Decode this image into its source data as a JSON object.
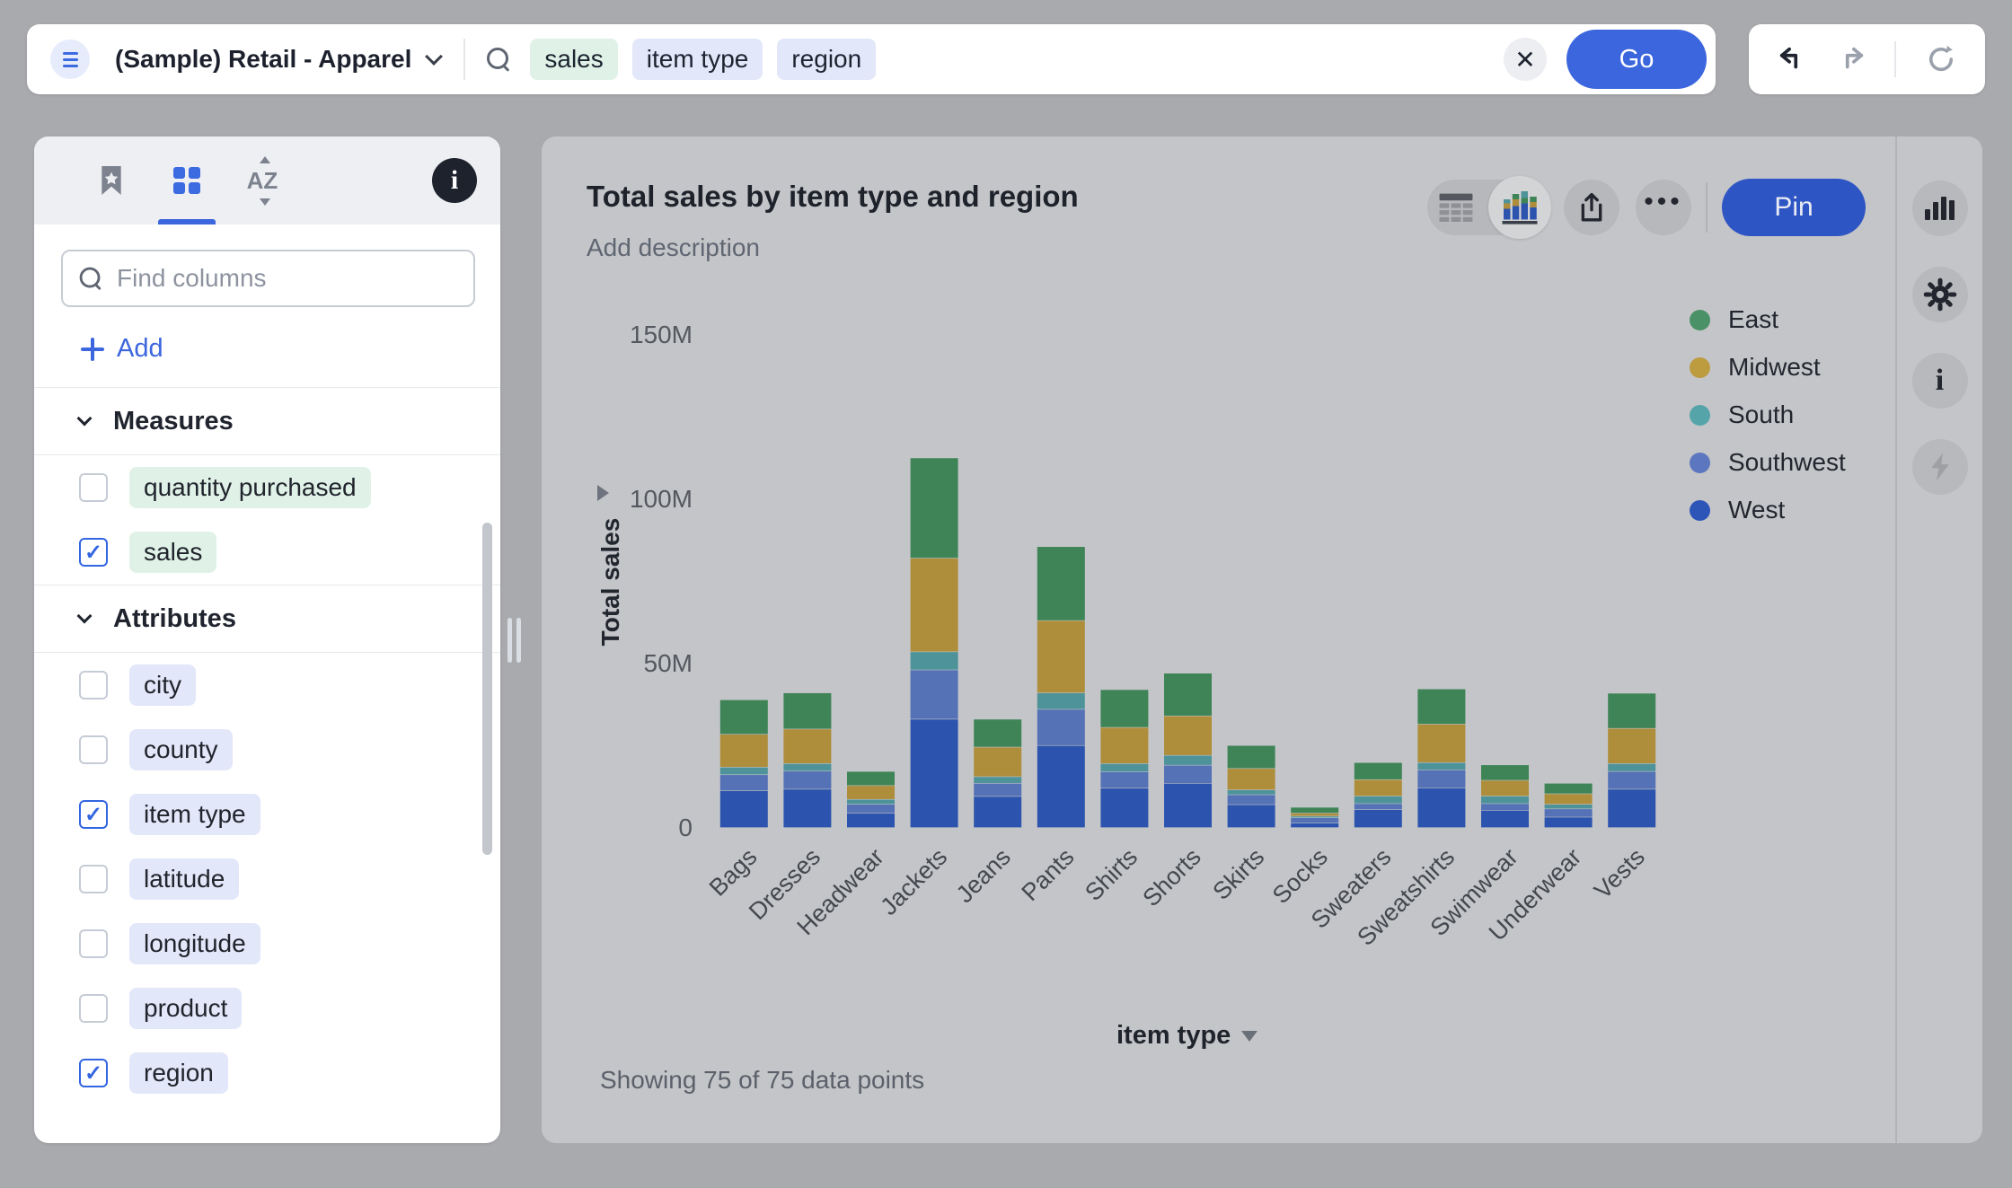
{
  "topbar": {
    "source_name": "(Sample) Retail - Apparel",
    "go_label": "Go",
    "tokens": [
      {
        "label": "sales",
        "kind": "measure"
      },
      {
        "label": "item type",
        "kind": "attribute"
      },
      {
        "label": "region",
        "kind": "attribute"
      }
    ]
  },
  "sidebar": {
    "search_placeholder": "Find columns",
    "add_label": "Add",
    "sections": [
      {
        "label": "Measures",
        "items": [
          {
            "label": "quantity purchased",
            "kind": "measure",
            "checked": false
          },
          {
            "label": "sales",
            "kind": "measure",
            "checked": true
          }
        ]
      },
      {
        "label": "Attributes",
        "items": [
          {
            "label": "city",
            "kind": "attribute",
            "checked": false
          },
          {
            "label": "county",
            "kind": "attribute",
            "checked": false
          },
          {
            "label": "item type",
            "kind": "attribute",
            "checked": true
          },
          {
            "label": "latitude",
            "kind": "attribute",
            "checked": false
          },
          {
            "label": "longitude",
            "kind": "attribute",
            "checked": false
          },
          {
            "label": "product",
            "kind": "attribute",
            "checked": false
          },
          {
            "label": "region",
            "kind": "attribute",
            "checked": true
          }
        ]
      }
    ]
  },
  "answer": {
    "title": "Total sales by item type and region",
    "description_placeholder": "Add description",
    "pin_label": "Pin",
    "status": "Showing 75 of 75 data points",
    "x_axis_label": "item type",
    "y_axis_label": "Total sales"
  },
  "chart_data": {
    "type": "bar",
    "stacked": true,
    "title": "Total sales by item type and region",
    "xlabel": "item type",
    "ylabel": "Total sales",
    "value_unit": "millions",
    "ylim": [
      0,
      150
    ],
    "y_ticks": [
      "0",
      "50M",
      "100M",
      "150M"
    ],
    "grid": false,
    "legend_position": "right",
    "categories": [
      "Bags",
      "Dresses",
      "Headwear",
      "Jackets",
      "Jeans",
      "Pants",
      "Shirts",
      "Shorts",
      "Skirts",
      "Socks",
      "Sweaters",
      "Sweatshirts",
      "Swimwear",
      "Underwear",
      "Vests"
    ],
    "stack_order_bottom_to_top": [
      "West",
      "Southwest",
      "South",
      "Midwest",
      "East"
    ],
    "series": [
      {
        "name": "East",
        "color": "#3e8456",
        "values": [
          10.5,
          11.0,
          4.3,
          30.5,
          8.5,
          22.5,
          11.5,
          13.0,
          7.0,
          1.8,
          5.2,
          10.7,
          4.7,
          3.2,
          10.7
        ]
      },
      {
        "name": "Midwest",
        "color": "#ae8d3b",
        "values": [
          10.0,
          10.5,
          4.2,
          28.5,
          9.0,
          22.0,
          11.0,
          12.0,
          6.5,
          0.9,
          5.0,
          11.7,
          4.8,
          3.2,
          10.7
        ]
      },
      {
        "name": "South",
        "color": "#4e939a",
        "values": [
          2.3,
          2.3,
          1.5,
          5.5,
          2.0,
          5.0,
          2.5,
          3.0,
          1.5,
          0.5,
          2.3,
          2.2,
          2.3,
          1.4,
          2.4
        ]
      },
      {
        "name": "Southwest",
        "color": "#5472b5",
        "values": [
          4.9,
          5.5,
          2.7,
          15.0,
          4.0,
          11.0,
          5.0,
          5.5,
          3.0,
          1.6,
          1.8,
          5.5,
          2.0,
          2.5,
          5.4
        ]
      },
      {
        "name": "West",
        "color": "#2c54ae",
        "values": [
          11.2,
          11.7,
          4.4,
          33.0,
          9.5,
          25.0,
          12.0,
          13.5,
          7.0,
          1.4,
          5.5,
          12.1,
          5.3,
          3.2,
          11.7
        ]
      }
    ],
    "legend_colors": {
      "East": "#4a9168",
      "Midwest": "#bd9b3f",
      "South": "#55a4aa",
      "Southwest": "#5c77c0",
      "West": "#2d55b8"
    }
  },
  "colors": {
    "accent": "#3b66dd",
    "pin": "#2e55c4",
    "measure_token_bg": "#e0f2e7",
    "attribute_token_bg": "#e2e7f9",
    "page_bg": "#a9aaad",
    "card_bg": "#c4c5c8"
  }
}
